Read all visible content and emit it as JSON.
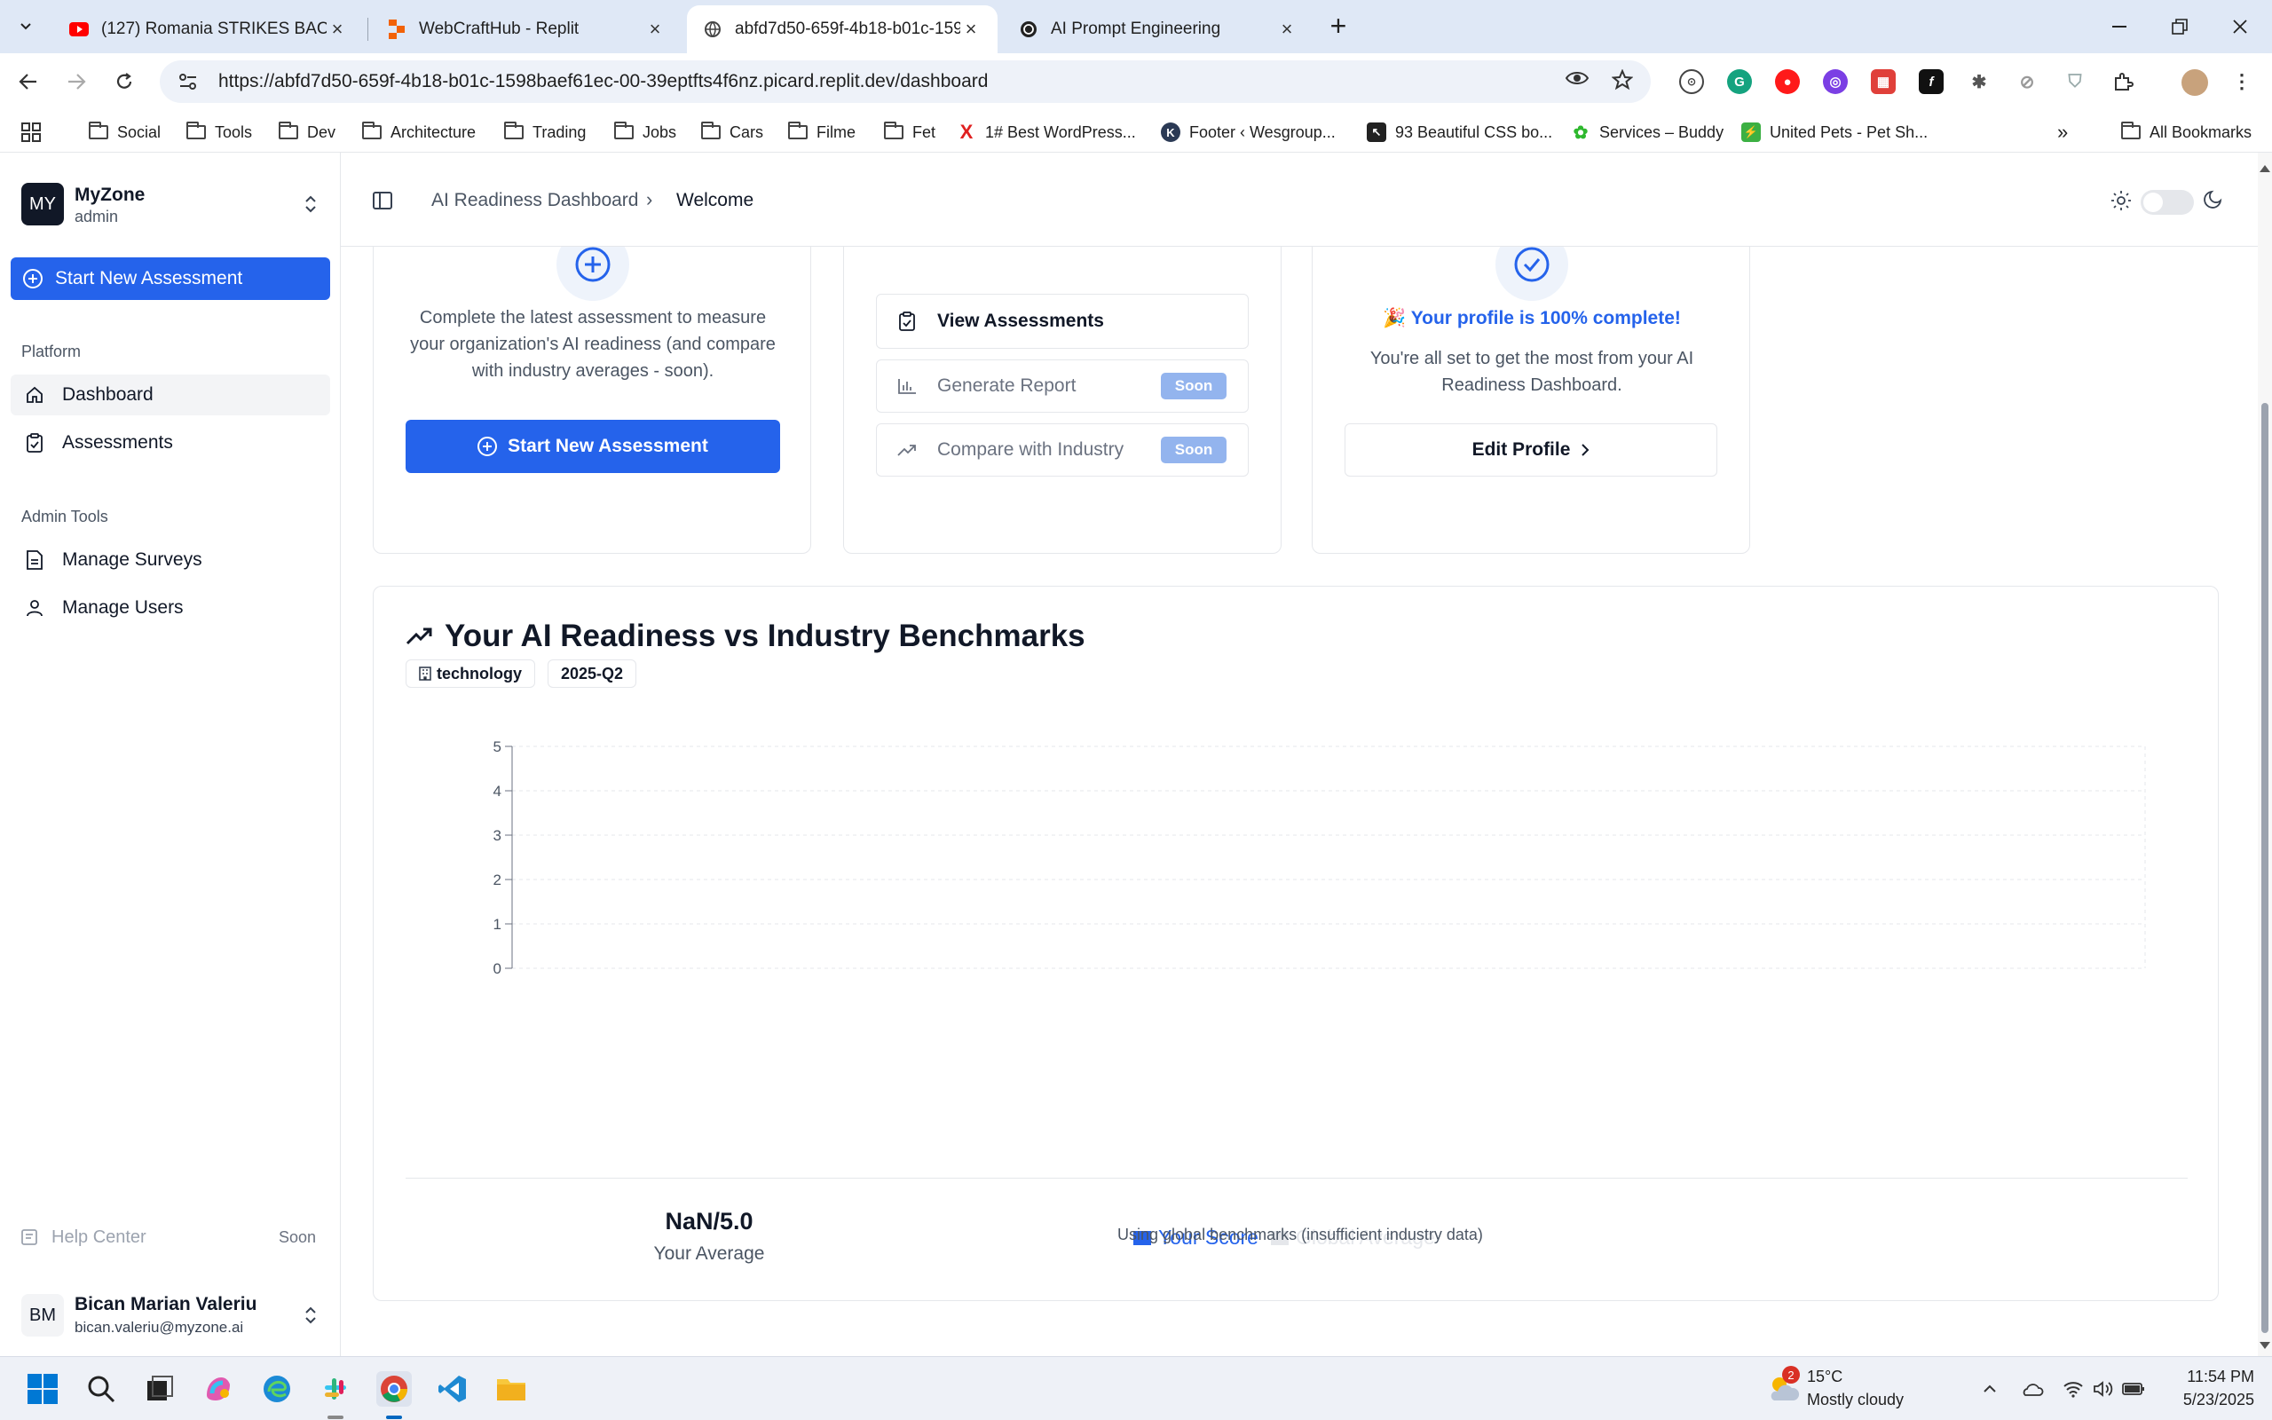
{
  "browser": {
    "tabs": [
      {
        "title": "(127) Romania STRIKES BACK...",
        "favicon": "youtube-icon"
      },
      {
        "title": "WebCraftHub - Replit",
        "favicon": "replit-icon"
      },
      {
        "title": "abfd7d50-659f-4b18-b01c-159...",
        "favicon": "globe-icon"
      },
      {
        "title": "AI Prompt Engineering",
        "favicon": "openai-icon"
      }
    ],
    "url": "https://abfd7d50-659f-4b18-b01c-1598baef61ec-00-39eptfts4f6nz.picard.replit.dev/dashboard",
    "bookmarks": [
      {
        "label": "Social",
        "type": "folder"
      },
      {
        "label": "Tools",
        "type": "folder"
      },
      {
        "label": "Dev",
        "type": "folder"
      },
      {
        "label": "Architecture",
        "type": "folder"
      },
      {
        "label": "Trading",
        "type": "folder"
      },
      {
        "label": "Jobs",
        "type": "folder"
      },
      {
        "label": "Cars",
        "type": "folder"
      },
      {
        "label": "Filme",
        "type": "folder"
      },
      {
        "label": "Fet",
        "type": "folder"
      },
      {
        "label": "1# Best WordPress...",
        "type": "site"
      },
      {
        "label": "Footer ‹ Wesgroup...",
        "type": "site"
      },
      {
        "label": "93 Beautiful CSS bo...",
        "type": "site"
      },
      {
        "label": "Services – Buddy",
        "type": "site"
      },
      {
        "label": "United Pets - Pet Sh...",
        "type": "site"
      }
    ],
    "all_bookmarks": "All Bookmarks",
    "overflow": "»"
  },
  "sidebar": {
    "org_initials": "MY",
    "org_name": "MyZone",
    "org_role": "admin",
    "start_button": "Start New Assessment",
    "platform_label": "Platform",
    "platform_items": [
      {
        "label": "Dashboard",
        "icon": "home-icon",
        "active": true
      },
      {
        "label": "Assessments",
        "icon": "clipboard-icon",
        "active": false
      }
    ],
    "admin_label": "Admin Tools",
    "admin_items": [
      {
        "label": "Manage Surveys",
        "icon": "document-icon"
      },
      {
        "label": "Manage Users",
        "icon": "user-icon"
      }
    ],
    "help": {
      "label": "Help Center",
      "badge": "Soon"
    },
    "user": {
      "initials": "BM",
      "name": "Bican Marian Valeriu",
      "email": "bican.valeriu@myzone.ai"
    }
  },
  "header": {
    "breadcrumb_parent": "AI Readiness Dashboard",
    "breadcrumb_sep": "›",
    "breadcrumb_current": "Welcome"
  },
  "cards": {
    "assessment": {
      "text": "Complete the latest assessment to measure your organization's AI readiness (and compare with industry averages - soon).",
      "button": "Start New Assessment"
    },
    "actions": {
      "view": "View Assessments",
      "report": "Generate Report",
      "report_badge": "Soon",
      "compare": "Compare with Industry",
      "compare_badge": "Soon"
    },
    "profile": {
      "emoji": "🎉",
      "headline": "Your profile is 100% complete!",
      "text": "You're all set to get the most from your AI Readiness Dashboard.",
      "button": "Edit Profile"
    }
  },
  "benchmark": {
    "title": "Your AI Readiness vs Industry Benchmarks",
    "tags": [
      "technology",
      "2025-Q2"
    ],
    "avg_value": "NaN/5.0",
    "avg_label": "Your Average",
    "note": "Using global benchmarks (insufficient industry data)"
  },
  "chart_data": {
    "type": "bar",
    "categories": [],
    "series": [
      {
        "name": "Your Score",
        "values": [],
        "color": "#2563eb"
      },
      {
        "name": "Global Average",
        "values": [],
        "color": "#e5e7eb"
      }
    ],
    "title": "",
    "xlabel": "",
    "ylabel": "",
    "ylim": [
      0,
      5
    ],
    "yticks": [
      "0",
      "1",
      "2",
      "3",
      "4",
      "5"
    ],
    "grid": true,
    "legend": "bottom"
  },
  "taskbar": {
    "weather_badge": "2",
    "temp": "15°C",
    "condition": "Mostly cloudy",
    "time": "11:54 PM",
    "date": "5/23/2025"
  },
  "colors": {
    "accent": "#2563eb",
    "badge": "#93b4ee"
  }
}
